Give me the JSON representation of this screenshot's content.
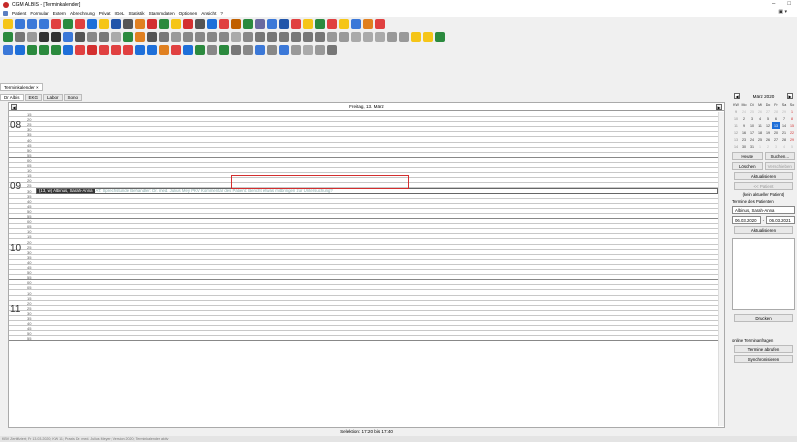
{
  "titlebar": {
    "title": "CGM ALBIS - [Terminkalender]",
    "minimize": "–",
    "maximize": "□"
  },
  "menubar": {
    "items": [
      "Patient",
      "Formular",
      "Extern",
      "Abrechnung",
      "Privat",
      "IGeL",
      "Statistik",
      "Stammdaten",
      "Optionen",
      "Ansicht",
      "?"
    ],
    "mdi_controls": "▣ ▾"
  },
  "toolbar_colors": {
    "row1": [
      "#f5c518",
      "#3b78d8",
      "#3b78d8",
      "#3b78d8",
      "#e04040",
      "#2b8a3e",
      "#e04040",
      "#1e6fd9",
      "#f5c518",
      "#2255aa",
      "#555",
      "#e08020",
      "#d32f2f",
      "#2b8a3e",
      "#f5c518",
      "#d32f2f",
      "#555",
      "#1e6fd9",
      "#e04040",
      "#c06000",
      "#2b8a3e",
      "#6a6aa0",
      "#3b78d8",
      "#2255aa",
      "#e04040",
      "#f5c518",
      "#2b8a3e",
      "#e04040",
      "#f5c518",
      "#3b78d8",
      "#e08020",
      "#e04040"
    ],
    "row2": [
      "#2b8a3e",
      "#777",
      "#999",
      "#333",
      "#333",
      "#3b78d8",
      "#555",
      "#888",
      "#777",
      "#aaa",
      "#2b8a3e",
      "#e08020",
      "#555",
      "#777",
      "#999",
      "#888",
      "#888",
      "#888",
      "#888",
      "#aaa",
      "#888",
      "#777",
      "#777",
      "#777",
      "#777",
      "#777",
      "#777",
      "#999",
      "#999",
      "#aaa",
      "#aaa",
      "#aaa",
      "#999",
      "#999",
      "#f5c518",
      "#f5c518",
      "#2b8a3e"
    ],
    "row3": [
      "#3b78d8",
      "#1e6fd9",
      "#2b8a3e",
      "#2b8a3e",
      "#2b8a3e",
      "#1e6fd9",
      "#e04040",
      "#d32f2f",
      "#e04040",
      "#e04040",
      "#e04040",
      "#1e6fd9",
      "#1e6fd9",
      "#e08020",
      "#e04040",
      "#1e6fd9",
      "#2b8a3e",
      "#888",
      "#2b8a3e",
      "#777",
      "#888",
      "#3b78d8",
      "#888",
      "#3b78d8",
      "#999",
      "#aaa",
      "#999",
      "#777"
    ]
  },
  "window_label": "Terminkalender",
  "tabs": [
    "Dr Albis",
    "EKG",
    "Labor",
    "Sono"
  ],
  "calendar": {
    "date_header": "Freitag, 13. März",
    "hours": [
      "08",
      "09",
      "10",
      "11"
    ],
    "minutes": [
      "00",
      "05",
      "10",
      "15",
      "20",
      "25",
      "30",
      "35",
      "40",
      "45",
      "50",
      "55"
    ],
    "first_minute_index": 3,
    "appointment": {
      "slot_index": 15,
      "patient": "(13, w) Albinus, Sarah-Anna",
      "details": "AT: Sprechstunde Behandler: Dr. med. Julius Mey ",
      "highlighted": "PKV Kommentar des Patient: Bericht etwas mitbringen zur Untersuchung?"
    },
    "selection": "Selektion: 17:20 bis 17:40"
  },
  "statusbar": "KBV Zertifiziert; Fr 13.03.2020; KW 11; Praxis Dr. med. Julius Meyer; Version 2020; Terminkalender aktiv",
  "sidebar": {
    "month": "März 2020",
    "weekday_header": [
      "KW",
      "Mo",
      "Di",
      "Mi",
      "Do",
      "Fr",
      "Sa",
      "So"
    ],
    "weeks": [
      [
        "9",
        "24",
        "25",
        "26",
        "27",
        "28",
        "29",
        "1"
      ],
      [
        "10",
        "2",
        "3",
        "4",
        "5",
        "6",
        "7",
        "8"
      ],
      [
        "11",
        "9",
        "10",
        "11",
        "12",
        "13",
        "14",
        "15"
      ],
      [
        "12",
        "16",
        "17",
        "18",
        "19",
        "20",
        "21",
        "22"
      ],
      [
        "13",
        "23",
        "24",
        "25",
        "26",
        "27",
        "28",
        "29"
      ],
      [
        "14",
        "30",
        "31",
        "1",
        "2",
        "3",
        "4",
        "5"
      ]
    ],
    "today": "13",
    "btn_today": "Heute",
    "btn_search": "Suchen...",
    "btn_delete": "Löschen",
    "btn_move": "Verschieben",
    "btn_refresh": "Aktualisieren",
    "btn_patient": "<< Patient",
    "no_patient": "(kein aktueller Patient)",
    "patient_terms_label": "Termine des Patienten",
    "patient_name": "Albinus, Sarah-Anna",
    "date_from": "06.03.2020",
    "date_sep": "-",
    "date_to": "06.03.2021",
    "btn_refresh2": "Aktualisieren",
    "btn_print": "Drucken",
    "online_label": "online Terminanfragen",
    "btn_fetch": "Termine abrufen",
    "btn_sync": "Synchronisieren"
  }
}
